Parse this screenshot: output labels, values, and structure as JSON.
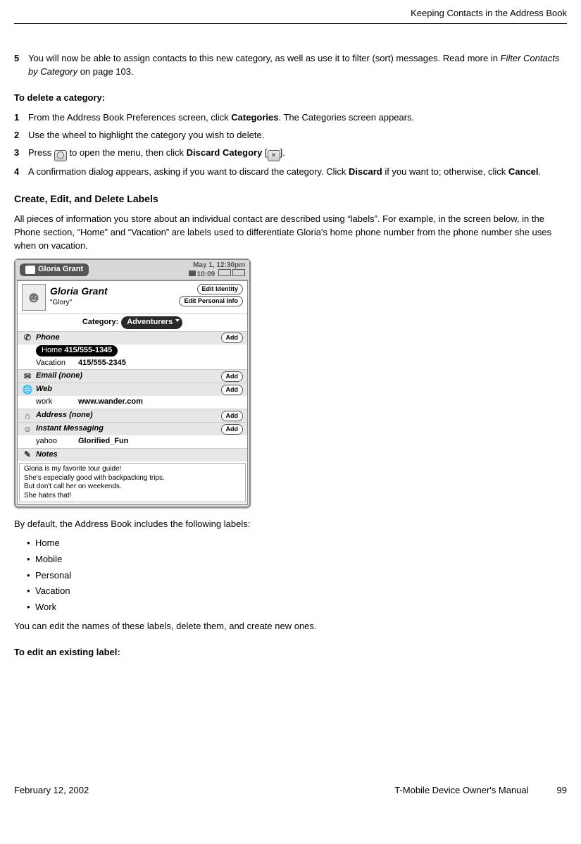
{
  "runningHead": "Keeping Contacts in the Address Book",
  "step5": {
    "num": "5",
    "textA": "You will now be able to assign contacts to this new category, as well as use it to filter (sort) messages. Read more in ",
    "textItalic": "Filter Contacts by Category",
    "textB": " on page 103."
  },
  "deleteHeading": {
    "lead": "To delete a category",
    "tail": ":"
  },
  "delSteps": {
    "s1": {
      "num": "1",
      "a": "From the Address Book Preferences screen, click ",
      "b": "Categories",
      "c": ". The Categories screen appears."
    },
    "s2": {
      "num": "2",
      "a": "Use the wheel to highlight the category you wish to delete."
    },
    "s3": {
      "num": "3",
      "a": "Press ",
      "b": " to open the menu, then click ",
      "c": "Discard Category",
      "d": " [",
      "e": "]."
    },
    "s4": {
      "num": "4",
      "a": "A confirmation dialog appears, asking if you want to discard the category. Click ",
      "b": "Discard",
      "c": " if you want to; otherwise, click ",
      "d": "Cancel",
      "e": "."
    }
  },
  "labelsHeading": "Create, Edit, and Delete Labels",
  "labelsIntro": "All pieces of information you store about an individual contact are described using “labels”. For example, in the screen below, in the Phone section, “Home” and “Vacation” are labels used to differentiate Gloria's home phone number from the phone number she uses when on vacation.",
  "device": {
    "tab": "Gloria Grant",
    "date": "May 1, 12:30pm",
    "time": "10:09",
    "name": "Gloria Grant",
    "nick": "\"Glory\"",
    "btnEditIdentity": "Edit Identity",
    "btnEditPersonal": "Edit Personal Info",
    "catLabel": "Category:",
    "catValue": "Adventurers",
    "add": "Add",
    "sections": {
      "phone": "Phone",
      "email": "Email (none)",
      "web": "Web",
      "address": "Address (none)",
      "im": "Instant Messaging",
      "notes": "Notes"
    },
    "phoneRows": {
      "homeLabel": "Home",
      "homeNum": "415/555-1345",
      "vacLabel": "Vacation",
      "vacNum": "415/555-2345"
    },
    "webRow": {
      "label": "work",
      "val": "www.wander.com"
    },
    "imRow": {
      "label": "yahoo",
      "val": "Glorified_Fun"
    },
    "notesLines": {
      "l1": "Gloria is my favorite tour guide!",
      "l2": "She's especially good with backpacking trips.",
      "l3": "But don't call her on weekends.",
      "l4": "She hates that!"
    }
  },
  "afterDevice": "By default, the Address Book includes the following labels:",
  "bullets": {
    "b1": "Home",
    "b2": "Mobile",
    "b3": "Personal",
    "b4": "Vacation",
    "b5": "Work"
  },
  "afterBullets": "You can edit the names of these labels, delete them, and create new ones.",
  "editHeading": {
    "lead": "To edit an existing label",
    "tail": ":"
  },
  "footer": {
    "left": "February 12, 2002",
    "center": "T-Mobile Device Owner's Manual",
    "right": "99"
  }
}
